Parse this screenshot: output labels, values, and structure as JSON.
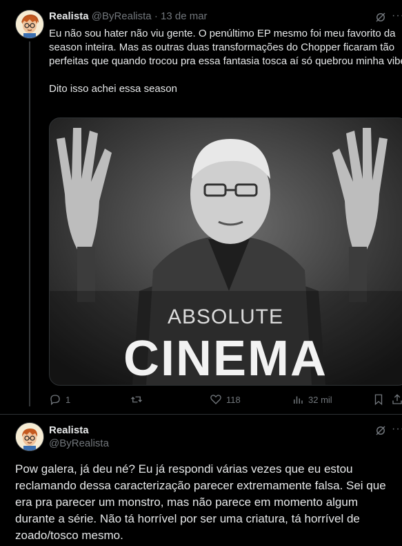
{
  "tweet1": {
    "display_name": "Realista",
    "handle": "@ByRealista",
    "separator": "·",
    "date": "13 de mar",
    "text_p1": "Eu não sou hater não viu gente. O penúltimo EP mesmo foi meu favorito da season inteira. Mas as outras duas transformações do Chopper ficaram tão perfeitas que quando trocou pra essa fantasia tosca aí só quebrou minha vibe.",
    "text_p2": "Dito isso achei essa season",
    "media": {
      "line1": "ABSOLUTE",
      "line2": "CINEMA"
    },
    "actions": {
      "replies": "1",
      "retweets": "",
      "likes": "118",
      "views": "32 mil"
    }
  },
  "tweet2": {
    "display_name": "Realista",
    "handle": "@ByRealista",
    "text": "Pow galera, já deu né? Eu já respondi várias vezes que eu estou reclamando dessa caracterização parecer extremamente falsa. Sei que era pra parecer um monstro, mas não parece em momento algum durante a série. Não tá horrível por ser uma criatura, tá horrível de zoado/tosco mesmo."
  },
  "colors": {
    "background": "#000000",
    "text": "#e7e9ea",
    "muted": "#71767b",
    "border": "#2f3336"
  }
}
